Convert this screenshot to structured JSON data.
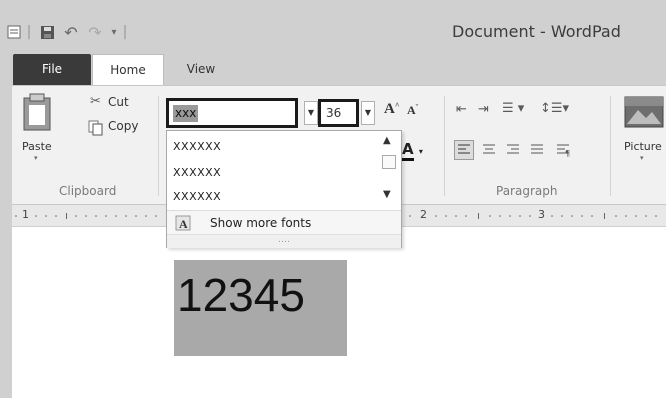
{
  "window": {
    "title": "Document - WordPad"
  },
  "quick_access": {
    "icons": [
      "app-menu-icon",
      "save-icon",
      "undo-icon",
      "redo-icon",
      "customize-icon"
    ]
  },
  "tabs": [
    {
      "label": "File"
    },
    {
      "label": "Home"
    },
    {
      "label": "View"
    }
  ],
  "clipboard": {
    "group_label": "Clipboard",
    "paste_label": "Paste",
    "cut_label": "Cut",
    "copy_label": "Copy"
  },
  "font": {
    "name_value": "xxx",
    "size_value": "36",
    "grow_glyph": "A",
    "shrink_glyph": "A",
    "color_glyph": "A"
  },
  "font_dropdown": {
    "items": [
      "XXXXXX",
      "XXXXXX",
      "XXXXXX"
    ],
    "show_more_label": "Show more fonts",
    "grip": "․․․․"
  },
  "paragraph": {
    "group_label": "Paragraph"
  },
  "insert": {
    "picture_label": "Picture"
  },
  "ruler": {
    "marks": [
      "1",
      "2",
      "3"
    ]
  },
  "document": {
    "text": "12345"
  },
  "colors": {
    "chrome": "#d0d0d0",
    "ribbon": "#f1f1f1",
    "selection": "#a9a9a9",
    "file_tab": "#3a3a3a"
  }
}
